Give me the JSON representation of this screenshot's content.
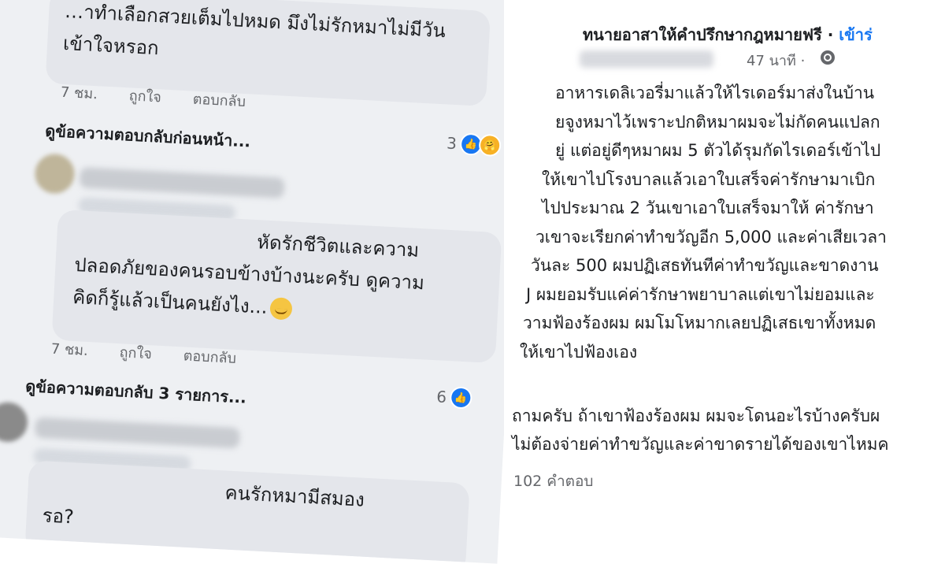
{
  "comments": {
    "first": {
      "lines": [
        "…าทำเลือกสวยเต็มไปหมด มึงไม่รักหมาไม่มีวัน",
        "เข้าใจหรอก"
      ],
      "time": "7 ชม.",
      "like": "ถูกใจ",
      "reply": "ตอบกลับ"
    },
    "view_previous": "ดูข้อความตอบกลับก่อนหน้า...",
    "first_reactions": "3",
    "second": {
      "lines": [
        "หัดรักชีวิตและความ",
        "ปลอดภัยของคนรอบข้างบ้างนะครับ ดูความ",
        "คิดก็รู้แล้วเป็นคนยังไง..."
      ],
      "time": "7 ชม.",
      "like": "ถูกใจ",
      "reply": "ตอบกลับ"
    },
    "view_replies": "ดูข้อความตอบกลับ 3 รายการ...",
    "second_reactions": "6",
    "third": {
      "lines": [
        "คนรักหมามีสมอง",
        "รอ?"
      ]
    }
  },
  "post": {
    "group_name": "ทนายอาสาให้คำปรึกษากฎหมายฟรี",
    "separator": " · ",
    "join": "เข้าร่",
    "time": "47 นาที ·",
    "body": [
      "อาหารเดลิเวอรี่มาแล้วให้ไรเดอร์มาส่งในบ้าน",
      "ยจูงหมาไว้เพราะปกติหมาผมจะไม่กัดคนแปลก",
      "ยู่ แต่อยู่ดีๆหมาผม 5 ตัวได้รุมกัดไรเดอร์เข้าไป",
      "ให้เขาไปโรงบาลแล้วเอาใบเสร็จค่ารักษามาเบิก",
      "ไปประมาณ 2 วันเขาเอาใบเสร็จมาให้ ค่ารักษา",
      "วเขาจะเรียกค่าทำขวัญอีก 5,000 และค่าเสียเวลา",
      "วันละ 500 ผมปฏิเสธทันทีค่าทำขวัญและขาดงาน",
      "J ผมยอมรับแค่ค่ารักษาพยาบาลแต่เขาไม่ยอมและ",
      "วามฟ้องร้องผม ผมโมโหมากเลยปฏิเสธเขาทั้งหมด",
      "ให้เขาไปฟ้องเอง"
    ],
    "question": [
      "ถามครับ ถ้าเขาฟ้องร้องผม ผมจะโดนอะไรบ้างครับผ",
      "ไม่ต้องจ่ายค่าทำขวัญและค่าขาดรายได้ของเขาไหมค"
    ],
    "reply_count": "102 คำตอบ"
  },
  "colors": {
    "accent": "#1877f2",
    "bubble": "#e4e6eb",
    "muted": "#65676b"
  }
}
